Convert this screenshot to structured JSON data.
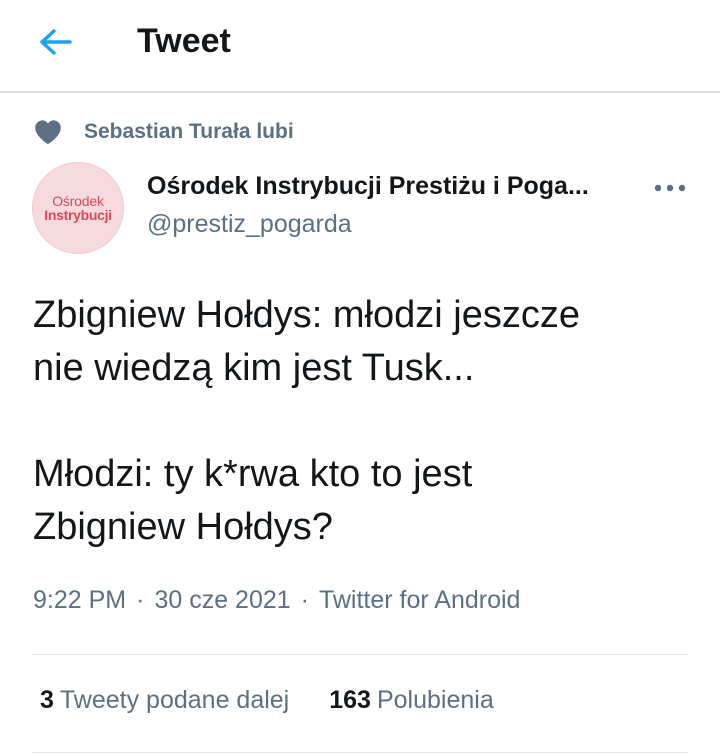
{
  "header": {
    "title": "Tweet",
    "back_icon": "arrow-left-icon",
    "accent": "#1da1f2"
  },
  "social_context": {
    "icon": "heart-icon",
    "text": "Sebastian Turała lubi"
  },
  "author": {
    "avatar_line1": "Ośrodek",
    "avatar_line2": "Instrybucji",
    "name": "Ośrodek Instrybucji Prestiżu i Poga...",
    "handle": "@prestiz_pogarda",
    "more_icon": "more-dots-icon"
  },
  "tweet": {
    "paragraph1_line1": "Zbigniew Hołdys: młodzi jeszcze",
    "paragraph1_line2": "nie wiedzą kim jest Tusk...",
    "paragraph2_line1": "Młodzi: ty k*rwa kto to jest",
    "paragraph2_line2": "Zbigniew Hołdys?"
  },
  "meta": {
    "time": "9:22 PM",
    "separator": "·",
    "date": "30 cze 2021",
    "source": "Twitter for Android"
  },
  "stats": {
    "retweets_count": "3",
    "retweets_label": "Tweety podane dalej",
    "likes_count": "163",
    "likes_label": "Polubienia"
  }
}
